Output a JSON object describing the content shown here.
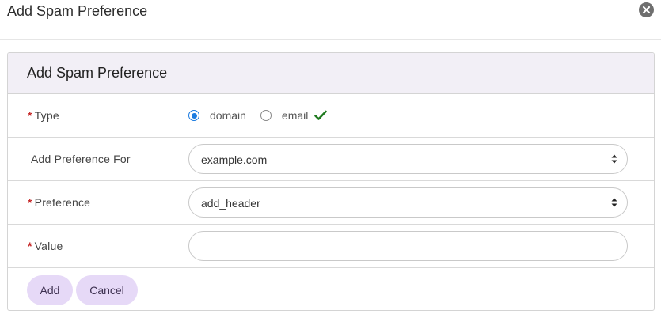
{
  "modal": {
    "title": "Add Spam Preference"
  },
  "panel": {
    "title": "Add Spam Preference"
  },
  "form": {
    "type": {
      "label": "Type",
      "required_mark": "*",
      "options": [
        {
          "label": "domain",
          "checked": true
        },
        {
          "label": "email",
          "checked": false
        }
      ]
    },
    "add_preference_for": {
      "label": "Add Preference For",
      "value": "example.com"
    },
    "preference": {
      "label": "Preference",
      "required_mark": "*",
      "value": "add_header"
    },
    "value": {
      "label": "Value",
      "required_mark": "*",
      "value": ""
    }
  },
  "actions": {
    "add_label": "Add",
    "cancel_label": "Cancel"
  },
  "colors": {
    "accent_radio": "#1b7be0",
    "check": "#1f7a1f",
    "button_bg": "#e6d9f7",
    "panel_head_bg": "#f2eff6",
    "required": "#c62828"
  },
  "icons": {
    "close": "close-circle-icon",
    "check": "checkmark-icon",
    "select": "sort-arrows-icon"
  }
}
